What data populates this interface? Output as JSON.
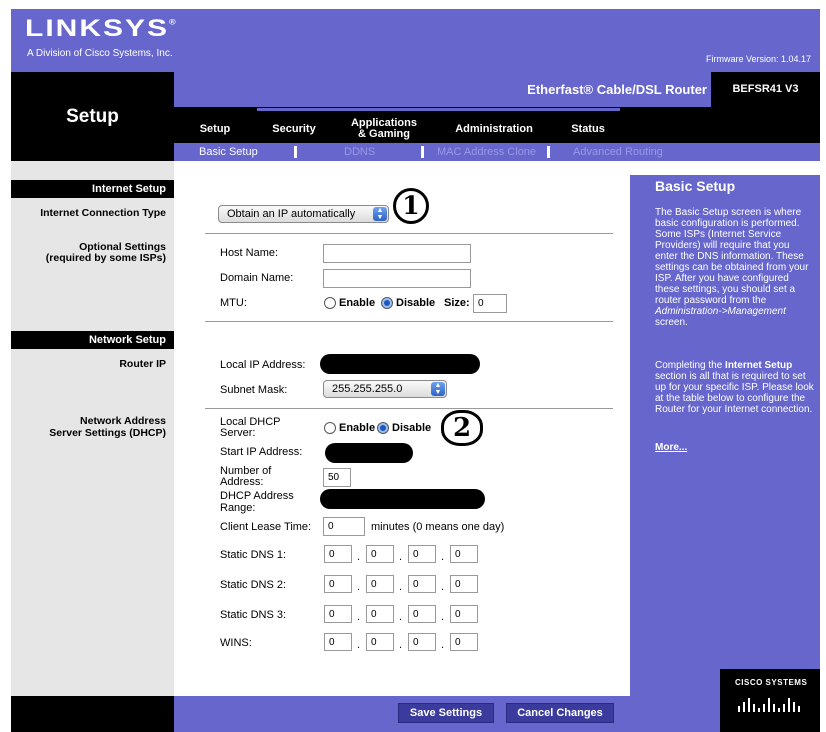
{
  "header": {
    "logo_text": "LINKSYS",
    "logo_reg": "®",
    "logo_sub": "A Division of Cisco Systems, Inc.",
    "firmware": "Firmware Version: 1.04.17",
    "section_title": "Setup",
    "product": "Etherfast® Cable/DSL Router",
    "model": "BEFSR41 V3"
  },
  "tabs": [
    {
      "label": "Setup"
    },
    {
      "label": "Security"
    },
    {
      "label": "Applications\n& Gaming",
      "line1": "Applications",
      "line2": "& Gaming"
    },
    {
      "label": "Administration"
    },
    {
      "label": "Status"
    }
  ],
  "subnav": [
    "Basic Setup",
    "DDNS",
    "MAC Address Clone",
    "Advanced Routing"
  ],
  "left": {
    "internet_setup": "Internet Setup",
    "connection_type": "Internet Connection Type",
    "optional_1": "Optional Settings",
    "optional_2": "(required by some ISPs)",
    "network_setup": "Network Setup",
    "router_ip": "Router IP",
    "nas_1": "Network Address",
    "nas_2": "Server Settings (DHCP)"
  },
  "internet": {
    "connection_select": "Obtain an IP automatically",
    "host_name_label": "Host Name:",
    "host_name_value": "",
    "domain_name_label": "Domain Name:",
    "domain_name_value": "",
    "mtu_label": "MTU:",
    "enable": "Enable",
    "disable": "Disable",
    "size_label": "Size:",
    "size_value": "0"
  },
  "router": {
    "local_ip_label": "Local IP Address:",
    "subnet_label": "Subnet Mask:",
    "subnet_value": "255.255.255.0"
  },
  "dhcp": {
    "local_dhcp_1": "Local DHCP",
    "local_dhcp_2": "Server:",
    "enable": "Enable",
    "disable": "Disable",
    "start_ip_label": "Start IP Address:",
    "num_1": "Number  of",
    "num_2": "Address:",
    "num_value": "50",
    "range_1": "DHCP  Address",
    "range_2": "Range:",
    "lease_label": "Client Lease Time:",
    "lease_value": "0",
    "lease_note": "minutes (0 means one day)",
    "dns1_label": "Static DNS 1:",
    "dns2_label": "Static DNS 2:",
    "dns3_label": "Static DNS 3:",
    "wins_label": "WINS:",
    "octet": "0"
  },
  "annotations": {
    "one": "1",
    "two": "2"
  },
  "help": {
    "title": "Basic Setup",
    "p1": "The Basic Setup screen is where basic configuration is performed. Some ISPs (Internet Service Providers) will require that you enter the DNS information. These settings can be obtained from your ISP. After you have configured these settings, you should set a router password from the",
    "p1_italic": "Administration->Management",
    "p1_end": "screen.",
    "p2_a": "Completing the",
    "p2_bold": "Internet Setup",
    "p2_b": "section is all that is required to set up for your specific ISP. Please look at the table below to configure the Router for your Internet connection.",
    "more": "More..."
  },
  "footer": {
    "save": "Save Settings",
    "cancel": "Cancel Changes",
    "cisco": "CISCO SYSTEMS"
  }
}
